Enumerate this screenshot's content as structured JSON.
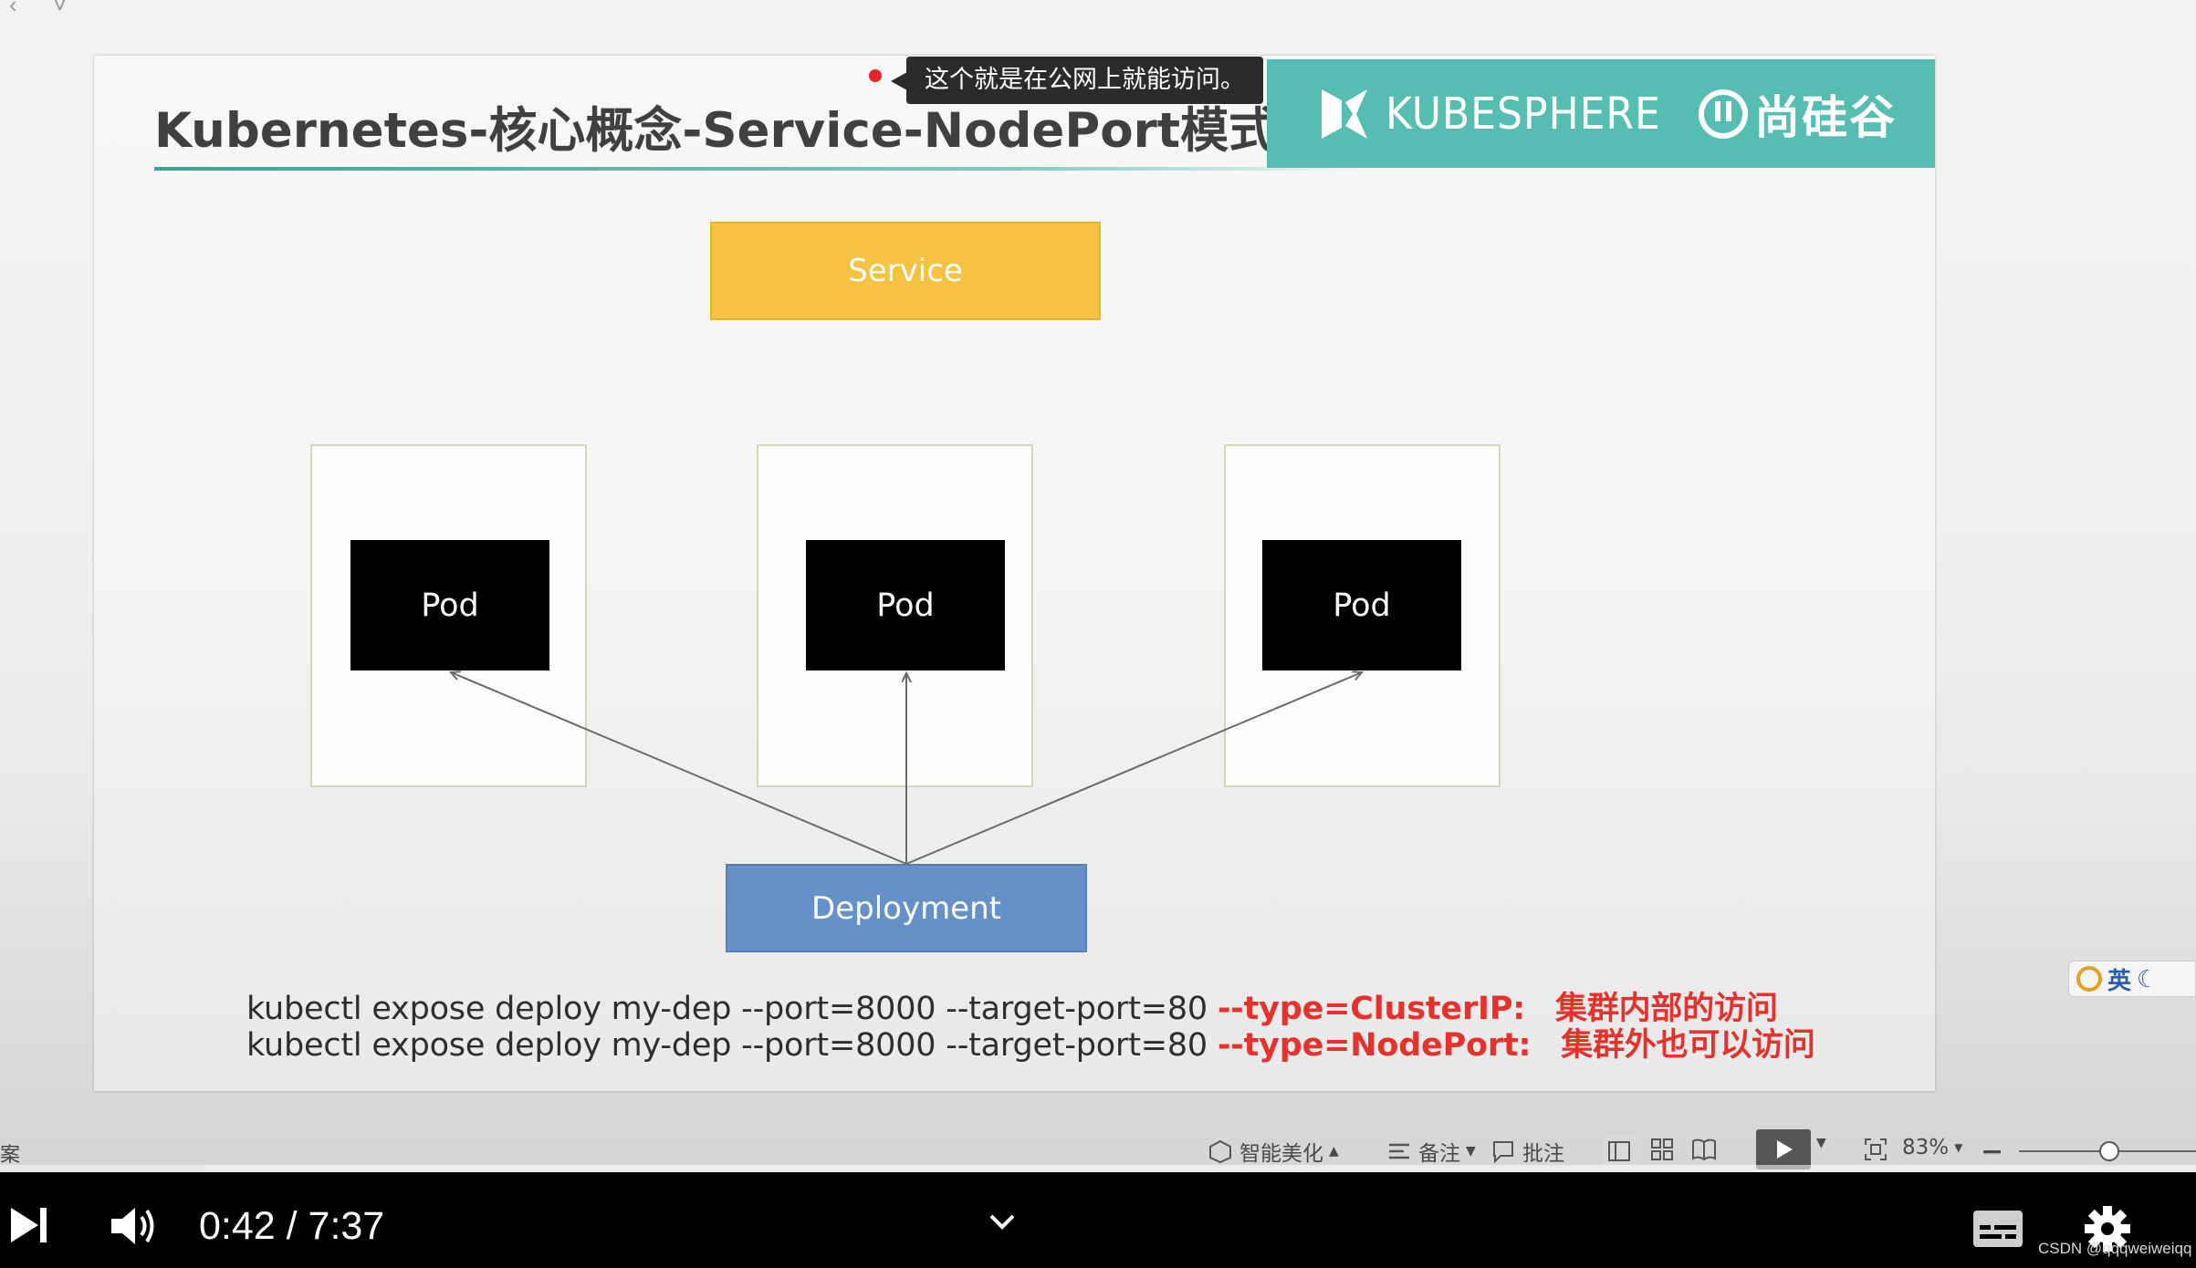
{
  "slide": {
    "title": "Kubernetes-核心概念-Service-NodePort模式",
    "brand_text": "KUBESPHERE",
    "brand_cn": "尚硅谷"
  },
  "tooltip": {
    "text": "这个就是在公网上就能访问。"
  },
  "diagram": {
    "service_label": "Service",
    "pods": [
      "Pod",
      "Pod",
      "Pod"
    ],
    "deployment_label": "Deployment"
  },
  "commands": [
    {
      "cmd": "kubectl expose deploy my-dep --port=8000 --target-port=80",
      "type": "--type=ClusterIP:",
      "desc": "集群内部的访问"
    },
    {
      "cmd": "kubectl expose deploy my-dep --port=8000 --target-port=80",
      "type": "--type=NodePort:",
      "desc": "集群外也可以访问"
    }
  ],
  "app_status_bar": {
    "left_text": "案",
    "beautify": "智能美化",
    "notes": "备注",
    "comment": "批注",
    "zoom": "83%"
  },
  "ime": {
    "label": "英"
  },
  "player": {
    "time": "0:42 / 7:37",
    "progress_percent": 9.3
  },
  "watermark": "CSDN @qqqweiweiqq",
  "colors": {
    "teal_banner": "#56bdb3",
    "service_yellow": "#f5c242",
    "deployment_blue": "#6690c8",
    "highlight_red": "#e5322d"
  }
}
